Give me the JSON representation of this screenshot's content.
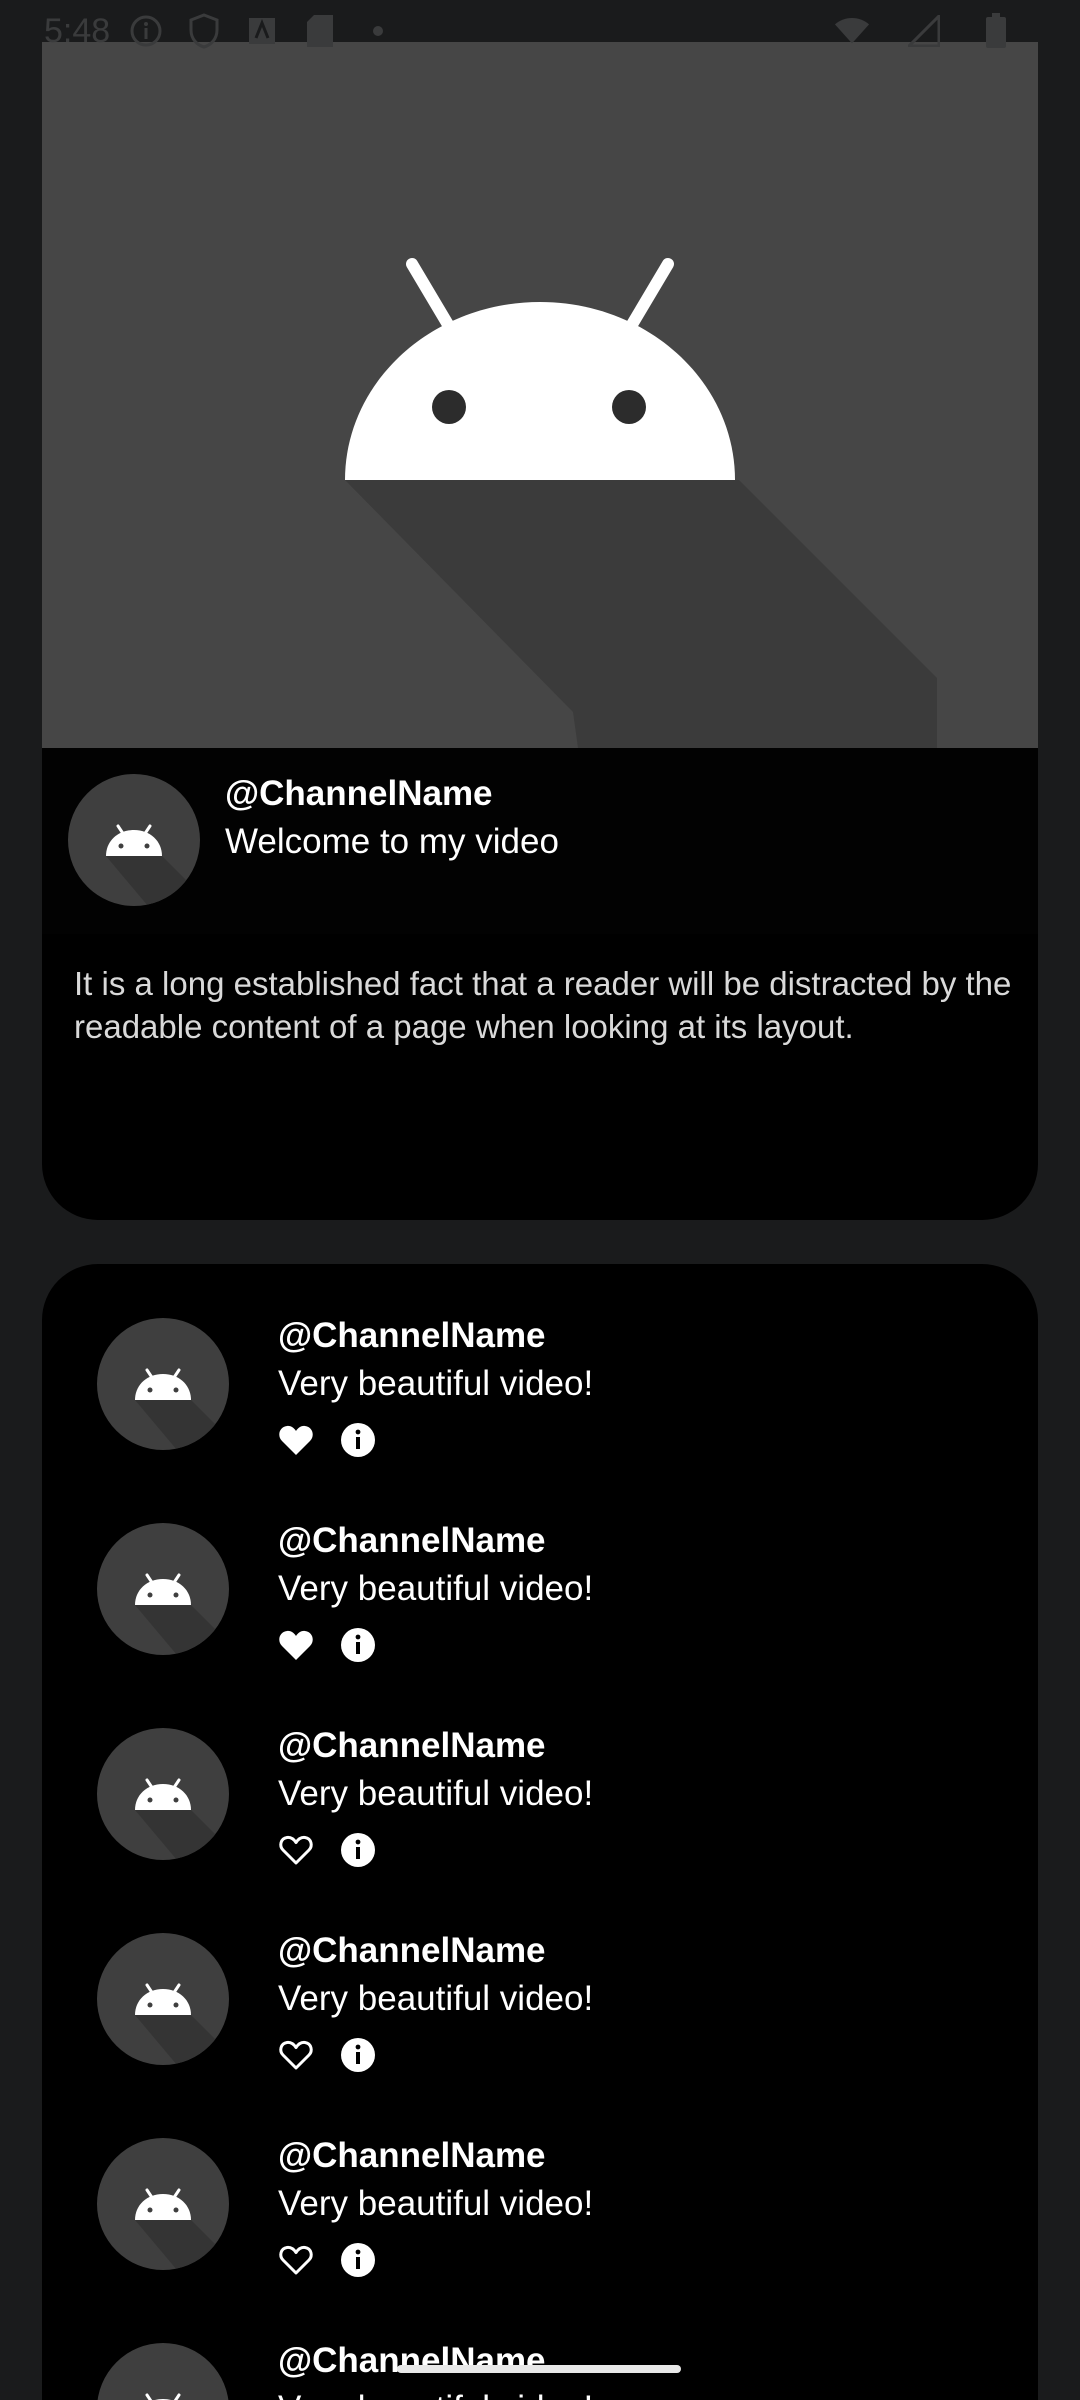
{
  "status_bar": {
    "time": "5:48",
    "icons": [
      "info-circle-icon",
      "shield-icon",
      "text-icon",
      "sd-card-icon",
      "dot-icon",
      "wifi-icon",
      "signal-icon",
      "battery-icon"
    ]
  },
  "video": {
    "thumbnail_icon": "android-icon",
    "channel_name": "@ChannelName",
    "title": "Welcome to my video",
    "description": "It is a long established fact that a reader will be distracted by the readable content of a page when looking at its layout."
  },
  "comments": [
    {
      "channel": "@ChannelName",
      "text": "Very beautiful video!",
      "liked": true
    },
    {
      "channel": "@ChannelName",
      "text": "Very beautiful video!",
      "liked": true
    },
    {
      "channel": "@ChannelName",
      "text": "Very beautiful video!",
      "liked": false
    },
    {
      "channel": "@ChannelName",
      "text": "Very beautiful video!",
      "liked": false
    },
    {
      "channel": "@ChannelName",
      "text": "Very beautiful video!",
      "liked": false
    },
    {
      "channel": "@ChannelName",
      "text": "Very beautiful video!",
      "liked": false
    }
  ],
  "colors": {
    "background": "#1a1b1c",
    "card": "#000000",
    "video_placeholder": "#464646",
    "avatar": "#3f3f3f",
    "text": "#ffffff",
    "description_text": "#d9d9d9"
  }
}
